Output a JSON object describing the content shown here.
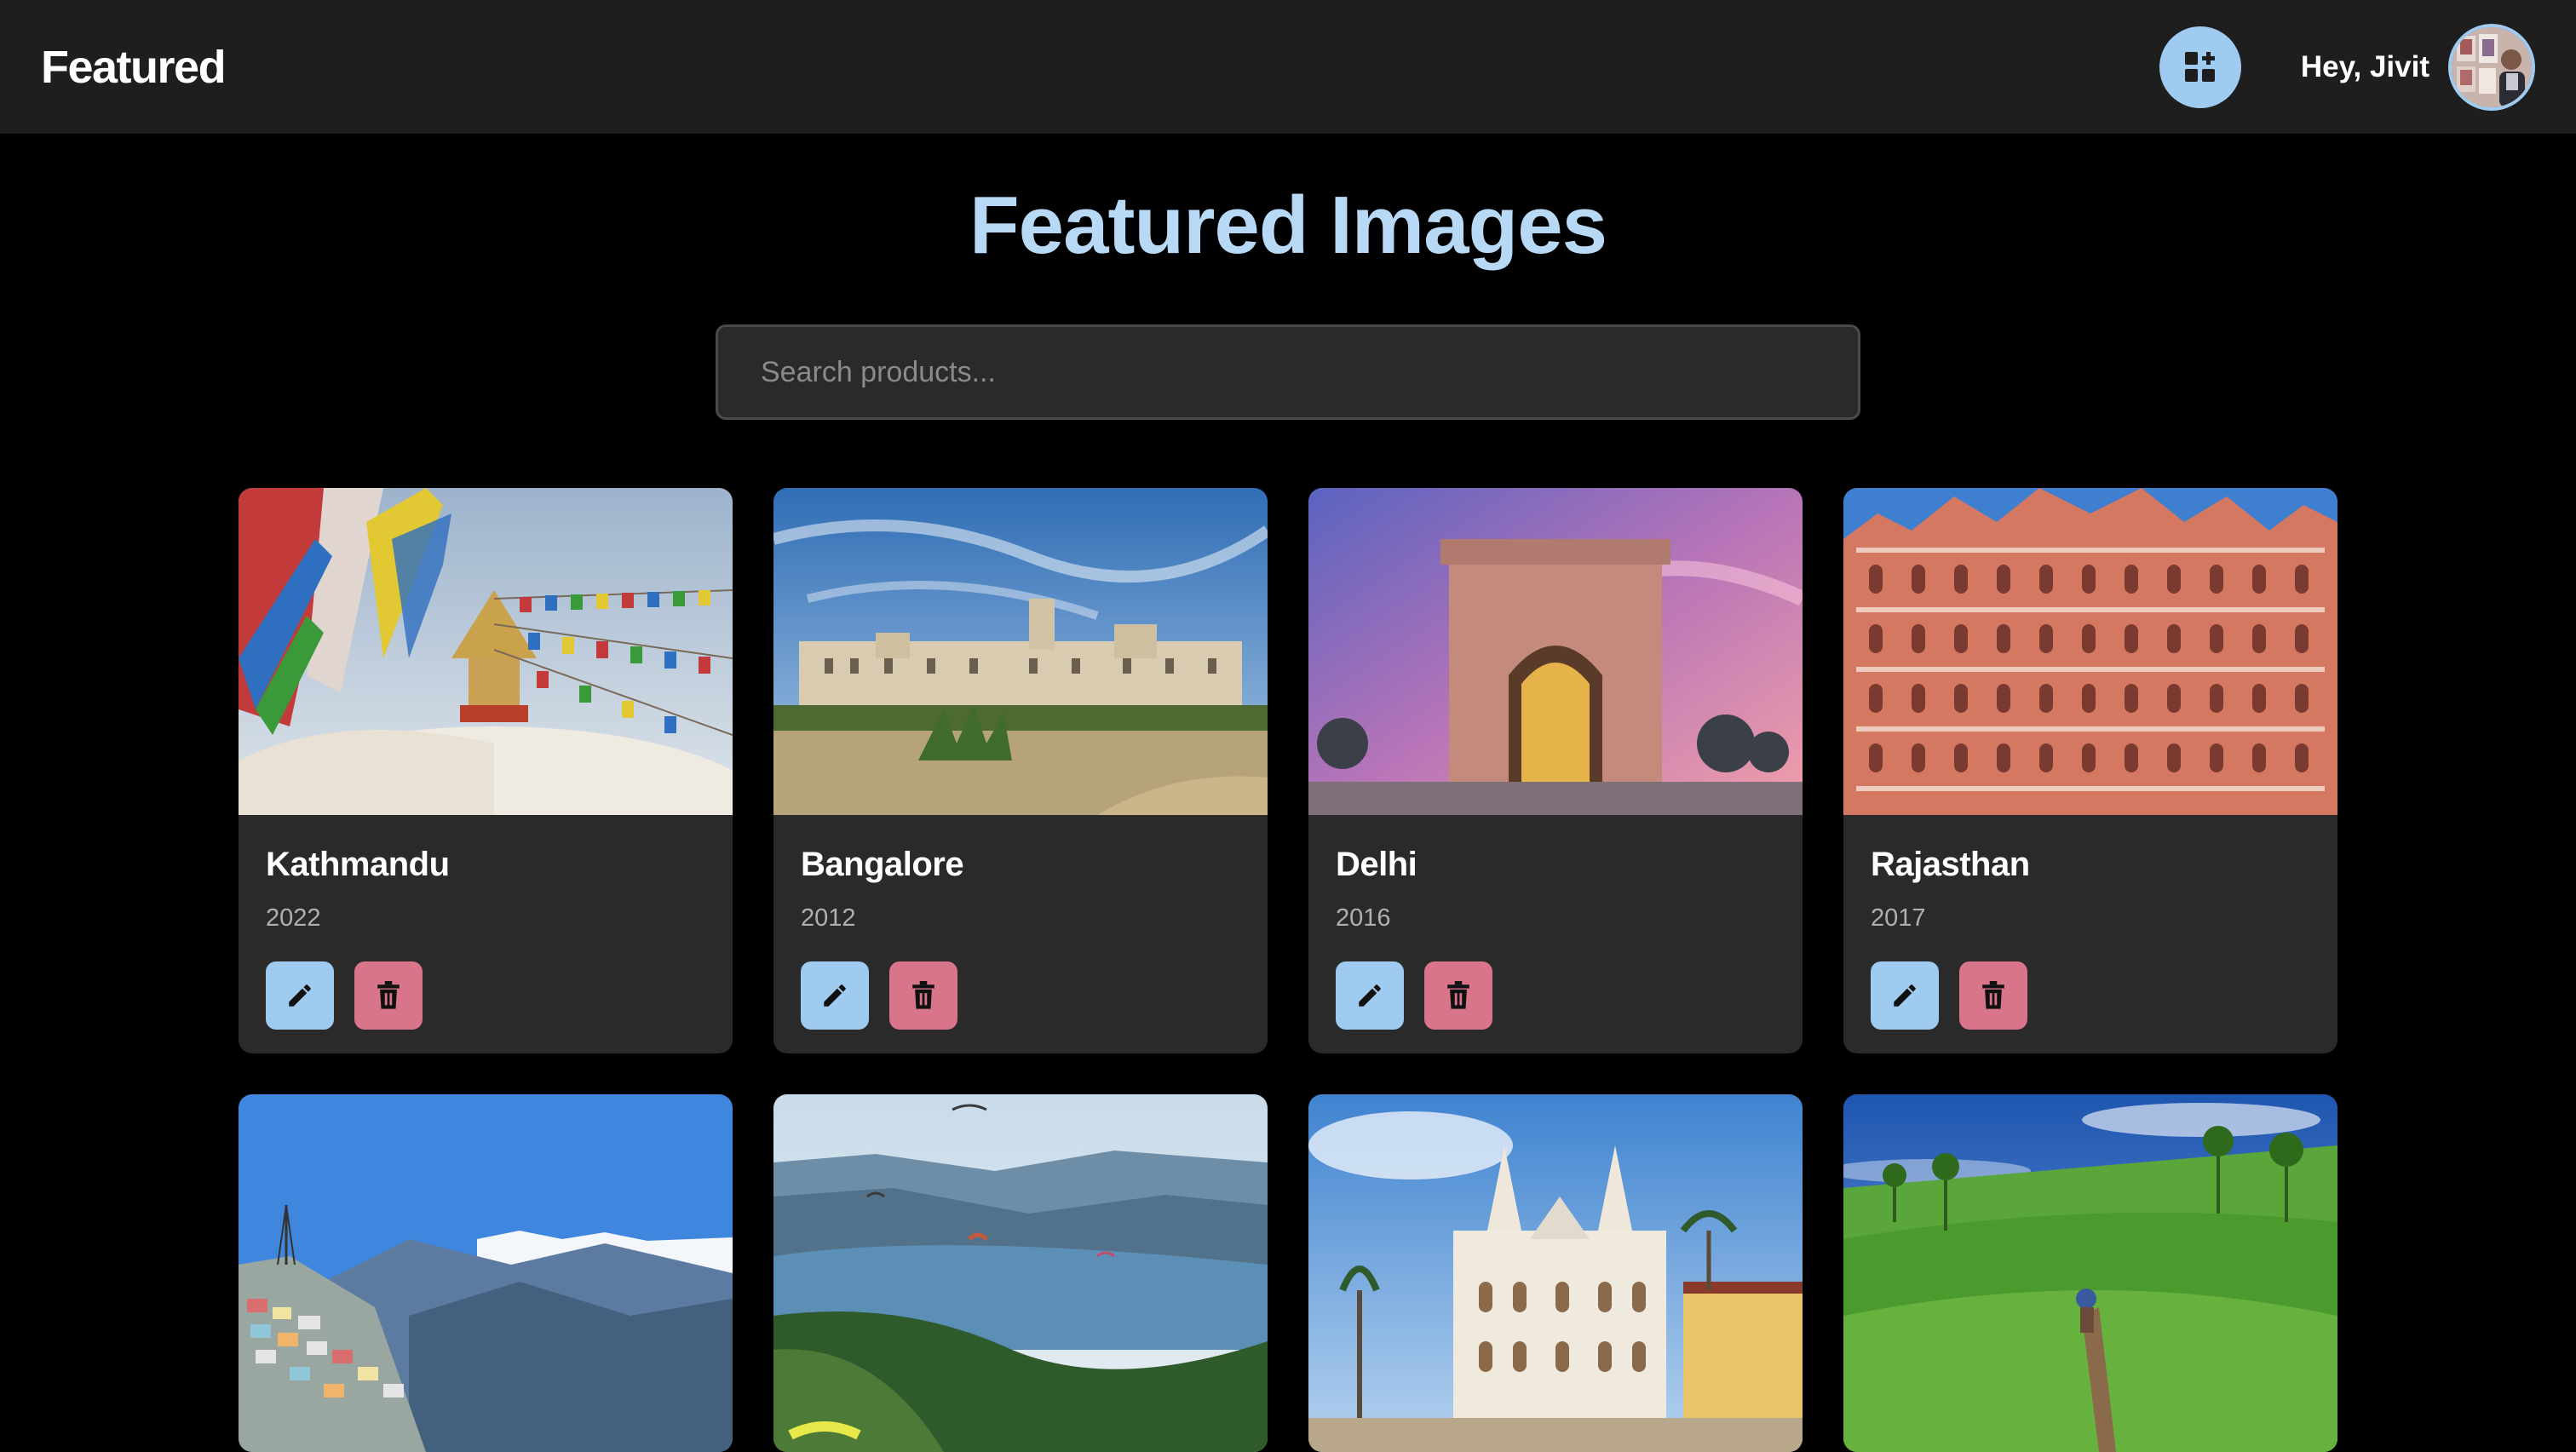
{
  "navbar": {
    "brand": "Featured",
    "add_icon": "add-grid-icon",
    "greeting": "Hey, Jivit",
    "avatar_icon": "user-avatar"
  },
  "page": {
    "title": "Featured Images"
  },
  "search": {
    "placeholder": "Search products...",
    "value": ""
  },
  "cards": [
    {
      "title": "Kathmandu",
      "year": "2022",
      "scene": "prayer-flags-stupa"
    },
    {
      "title": "Bangalore",
      "year": "2012",
      "scene": "palace"
    },
    {
      "title": "Delhi",
      "year": "2016",
      "scene": "india-gate"
    },
    {
      "title": "Rajasthan",
      "year": "2017",
      "scene": "hawa-mahal"
    }
  ],
  "cards_row2": [
    {
      "scene": "hill-town-mountains"
    },
    {
      "scene": "lake-paragliding"
    },
    {
      "scene": "church"
    },
    {
      "scene": "tea-plantation"
    }
  ],
  "colors": {
    "accent": "#9ecbef",
    "title": "#b8d9f5",
    "delete": "#d9758a",
    "card_bg": "#2a2a2a",
    "nav_bg": "#1e1e1e",
    "page_bg": "#000000"
  },
  "icons": {
    "edit": "pencil-icon",
    "delete": "trash-icon"
  }
}
